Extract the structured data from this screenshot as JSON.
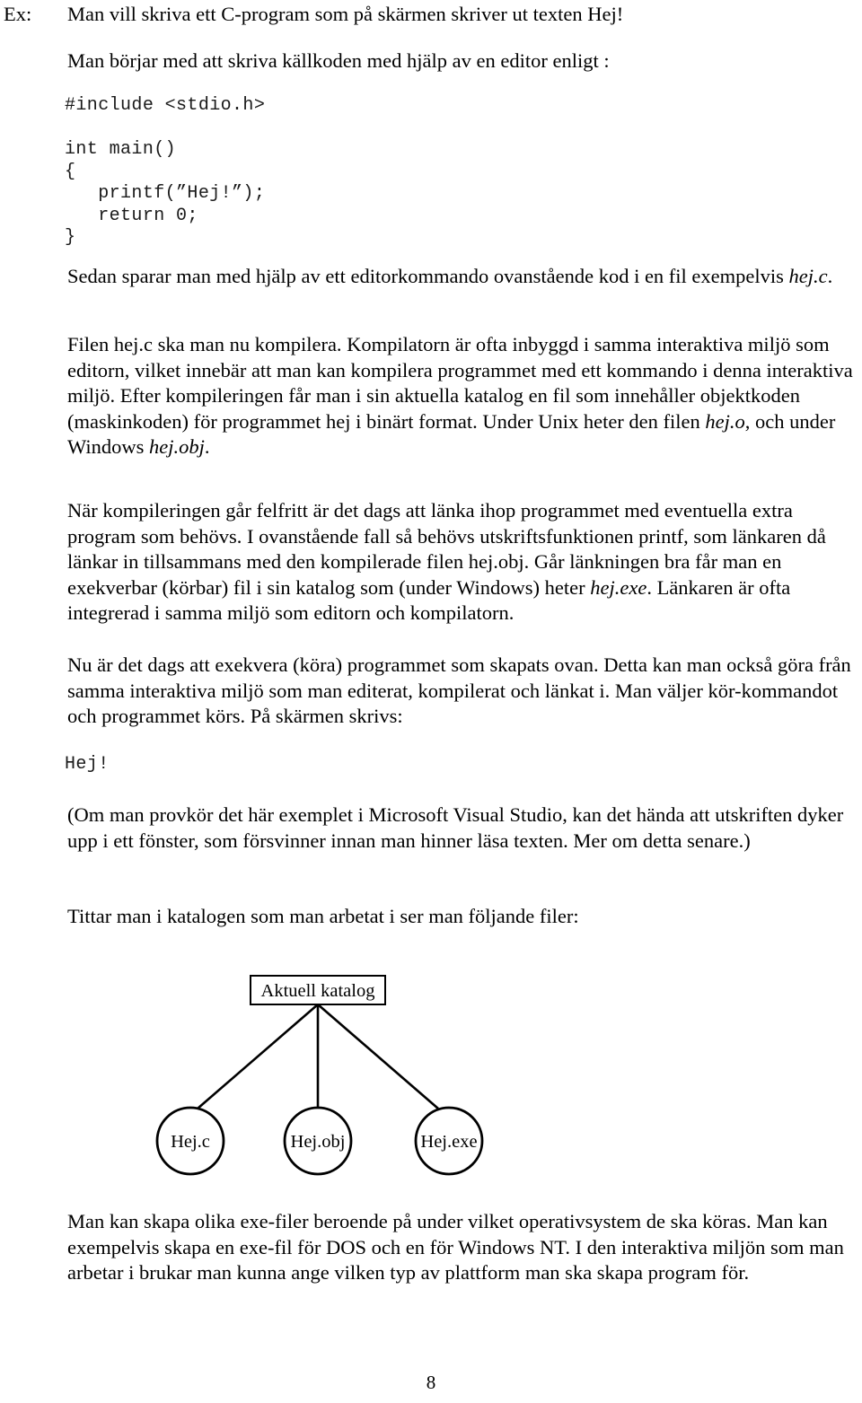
{
  "document": {
    "language": "sv",
    "page_number": "8"
  },
  "example": {
    "label": "Ex:",
    "intro": "Man vill skriva ett C-program som på skärmen skriver ut texten Hej!",
    "editor_line": "Man börjar med att skriva källkoden med hjälp av en editor enligt :"
  },
  "code": {
    "include_line": "#include <stdio.h>",
    "main_block": "int main()\n{\n   printf(”Hej!”);\n   return 0;\n}",
    "program_output": "Hej!"
  },
  "paragraphs": {
    "save": {
      "before_italic": "Sedan sparar man med hjälp av ett editorkommando ovanstående kod i en fil exempelvis ",
      "italic": "hej.c",
      "after_italic": "."
    },
    "compile": {
      "part1": "Filen hej.c ska man nu kompilera. Kompilatorn är ofta inbyggd i samma interaktiva miljö som editorn, vilket innebär att man kan kompilera programmet med ett kommando i denna interaktiva miljö. Efter kompileringen får man i sin aktuella katalog en fil som innehåller objektkoden (maskinkoden) för programmet hej i binärt format. Under Unix heter den filen ",
      "italic1": "hej.o",
      "part2": ", och under Windows ",
      "italic2": "hej.obj",
      "part3": "."
    },
    "link": {
      "part1": "När kompileringen går felfritt är det dags att länka ihop programmet med eventuella extra program som behövs. I ovanstående fall så behövs utskriftsfunktionen printf, som länkaren då länkar in tillsammans med den kompilerade filen hej.obj. Går länkningen bra får man en exekverbar (körbar) fil i sin katalog som (under Windows) heter ",
      "italic1": "hej.exe",
      "part2": ". Länkaren är ofta integrerad i samma miljö som editorn och kompilatorn."
    },
    "run": "Nu är det dags att exekvera (köra) programmet som skapats ovan. Detta kan man också göra från samma interaktiva miljö som man editerat, kompilerat och länkat i. Man väljer kör-kommandot och programmet körs. På skärmen skrivs:",
    "note": "(Om man provkör det här exemplet i Microsoft Visual Studio, kan det hända att utskriften dyker upp i ett fönster, som försvinner innan man hinner läsa texten. Mer om detta senare.)",
    "directory_intro": "Tittar man i katalogen som man arbetat i ser man följande filer:",
    "exe_files": "Man kan skapa olika exe-filer beroende på under vilket operativsystem de ska köras. Man kan exempelvis skapa en exe-fil för DOS och en för Windows NT. I den interaktiva miljön som man arbetar i brukar man kunna ange vilken typ av plattform man ska skapa program för."
  },
  "diagram": {
    "root_box_label": "Aktuell katalog",
    "nodes": [
      {
        "label": "Hej.c"
      },
      {
        "label": "Hej.obj"
      },
      {
        "label": "Hej.exe"
      }
    ],
    "stroke_color": "#000000",
    "fill_color": "#ffffff"
  }
}
